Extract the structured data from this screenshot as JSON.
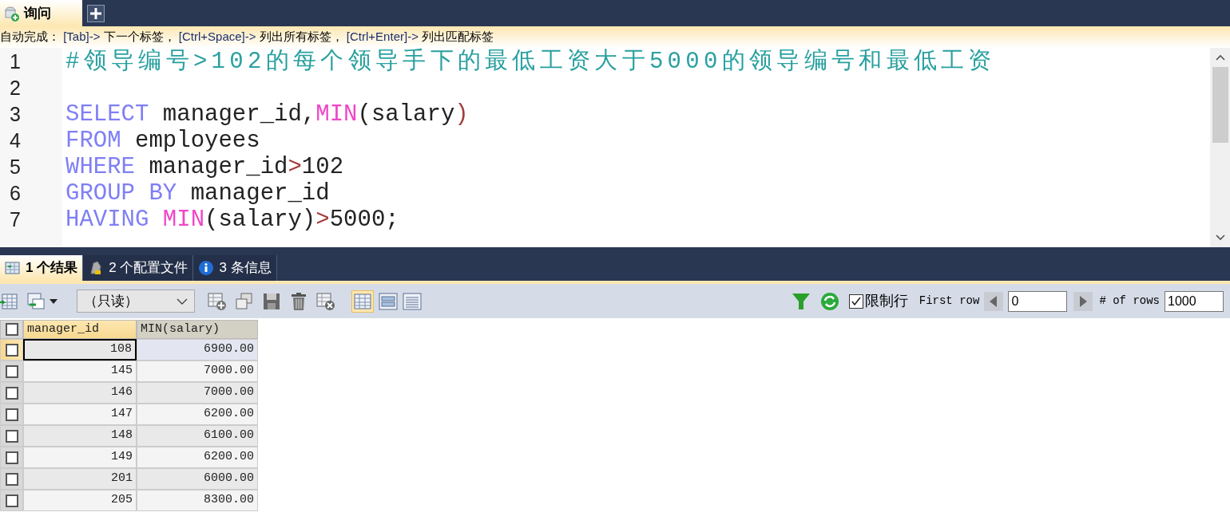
{
  "query_tabs": [
    {
      "label": "询问",
      "selected": true
    }
  ],
  "hint": [
    {
      "kind": "text",
      "text": "自动完成： "
    },
    {
      "kind": "key",
      "text": "[Tab]->"
    },
    {
      "kind": "text",
      "text": " 下一个标签， "
    },
    {
      "kind": "key",
      "text": "[Ctrl+Space]->"
    },
    {
      "kind": "text",
      "text": " 列出所有标签， "
    },
    {
      "kind": "key",
      "text": "[Ctrl+Enter]->"
    },
    {
      "kind": "text",
      "text": " 列出匹配标签"
    }
  ],
  "editor": {
    "lines": [
      {
        "number": "1",
        "tokens": [
          {
            "kind": "comment",
            "text": "#领导编号>102的每个领导手下的最低工资大于5000的领导编号和最低工资"
          }
        ]
      },
      {
        "number": "2"
      },
      {
        "number": "3",
        "tokens": [
          {
            "kind": "keyword",
            "text": "SELECT"
          },
          {
            "kind": "plain",
            "text": " manager_id,"
          },
          {
            "kind": "function",
            "text": "MIN"
          },
          {
            "kind": "plain",
            "text": "(salary"
          },
          {
            "kind": "operator",
            "text": ")"
          }
        ]
      },
      {
        "number": "4",
        "tokens": [
          {
            "kind": "keyword",
            "text": "FROM"
          },
          {
            "kind": "plain",
            "text": " employees"
          }
        ]
      },
      {
        "number": "5",
        "tokens": [
          {
            "kind": "keyword",
            "text": "WHERE"
          },
          {
            "kind": "plain",
            "text": " manager_id"
          },
          {
            "kind": "operator",
            "text": ">"
          },
          {
            "kind": "plain",
            "text": "102"
          }
        ]
      },
      {
        "number": "6",
        "tokens": [
          {
            "kind": "keyword",
            "text": "GROUP BY"
          },
          {
            "kind": "plain",
            "text": " manager_id"
          }
        ]
      },
      {
        "number": "7",
        "tokens": [
          {
            "kind": "keyword",
            "text": "HAVING "
          },
          {
            "kind": "function",
            "text": "MIN"
          },
          {
            "kind": "plain",
            "text": "(salary)"
          },
          {
            "kind": "operator",
            "text": ">"
          },
          {
            "kind": "plain",
            "text": "5000;"
          }
        ]
      }
    ]
  },
  "result_tabs": [
    {
      "label": "1 个结果",
      "selected": true
    },
    {
      "label": "2 个配置文件",
      "selected": false
    },
    {
      "label": "3 条信息",
      "selected": false
    }
  ],
  "toolbar": {
    "mode_select": {
      "value": "（只读）"
    },
    "limit_rows": {
      "label": "限制行",
      "checked": true
    },
    "first_row": {
      "label": "First row",
      "value": "0"
    },
    "row_count": {
      "label": "# of rows",
      "value": "1000"
    }
  },
  "grid": {
    "all_checked": false,
    "columns": [
      "manager_id",
      "MIN(salary)"
    ],
    "rows": [
      {
        "cells": [
          "108",
          "6900.00"
        ],
        "selected": true,
        "checked": false
      },
      {
        "cells": [
          "145",
          "7000.00"
        ],
        "selected": false,
        "checked": false
      },
      {
        "cells": [
          "146",
          "7000.00"
        ],
        "selected": false,
        "checked": false
      },
      {
        "cells": [
          "147",
          "6200.00"
        ],
        "selected": false,
        "checked": false
      },
      {
        "cells": [
          "148",
          "6100.00"
        ],
        "selected": false,
        "checked": false
      },
      {
        "cells": [
          "149",
          "6200.00"
        ],
        "selected": false,
        "checked": false
      },
      {
        "cells": [
          "201",
          "6000.00"
        ],
        "selected": false,
        "checked": false
      },
      {
        "cells": [
          "205",
          "8300.00"
        ],
        "selected": false,
        "checked": false
      }
    ]
  }
}
